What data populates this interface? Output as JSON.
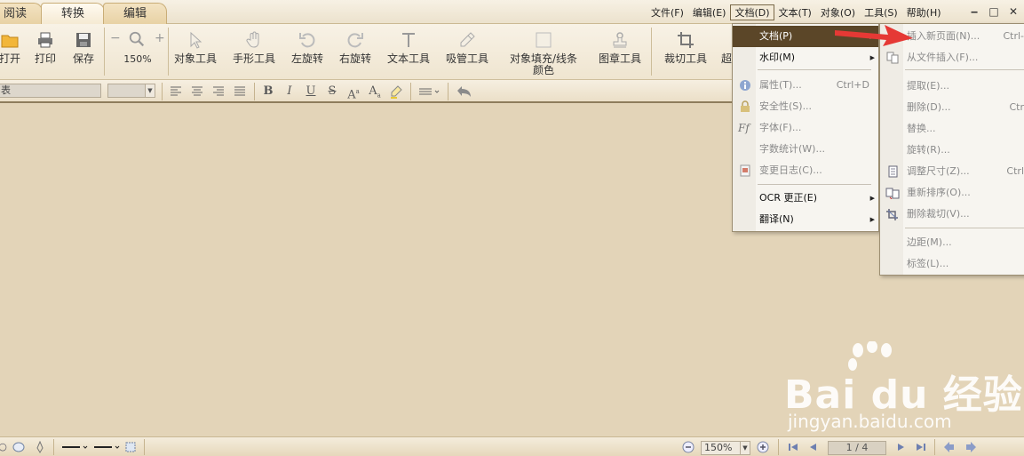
{
  "tabs": [
    "阅读",
    "转换",
    "编辑"
  ],
  "menubar": [
    "文件(F)",
    "编辑(E)",
    "文档(D)",
    "文本(T)",
    "对象(O)",
    "工具(S)",
    "帮助(H)"
  ],
  "window_buttons": [
    "‒",
    "□",
    "✕"
  ],
  "toolbar": {
    "open": "打开",
    "print": "打印",
    "save": "保存",
    "zoom_minus": "−",
    "zoom_plus": "+",
    "zoom": "150%",
    "object_tool": "对象工具",
    "hand_tool": "手形工具",
    "rotate_left": "左旋转",
    "rotate_right": "右旋转",
    "text_tool": "文本工具",
    "eyedropper": "吸管工具",
    "fill_stroke": "对象填充/线条颜色",
    "stamp_tool": "图章工具",
    "crop_tool": "裁切工具",
    "more": "超"
  },
  "format_bar": {
    "font_value": "表"
  },
  "doc_menu": {
    "items": [
      {
        "label": "文档(P)",
        "highlighted": true,
        "submenu": true
      },
      {
        "label": "水印(M)",
        "submenu": true
      },
      {
        "label": "属性(T)...",
        "shortcut": "Ctrl+D",
        "disabled": true
      },
      {
        "label": "安全性(S)...",
        "disabled": true
      },
      {
        "label": "字体(F)...",
        "disabled": true
      },
      {
        "label": "字数统计(W)...",
        "disabled": true
      },
      {
        "label": "变更日志(C)...",
        "disabled": true
      },
      {
        "label": "OCR 更正(E)",
        "submenu": true
      },
      {
        "label": "翻译(N)",
        "submenu": true
      }
    ],
    "font_icon_text": "Ff"
  },
  "page_submenu": {
    "items": [
      {
        "label": "插入新页面(N)...",
        "shortcut": "Ctrl-"
      },
      {
        "label": "从文件插入(F)..."
      },
      {
        "label": "提取(E)..."
      },
      {
        "label": "删除(D)...",
        "shortcut": "Ctr"
      },
      {
        "label": "替换..."
      },
      {
        "label": "旋转(R)..."
      },
      {
        "label": "调整尺寸(Z)...",
        "shortcut": "Ctrl"
      },
      {
        "label": "重新排序(O)..."
      },
      {
        "label": "删除裁切(V)..."
      },
      {
        "label": "边距(M)..."
      },
      {
        "label": "标签(L)..."
      }
    ]
  },
  "statusbar": {
    "zoom": "150%",
    "page": "1 / 4"
  },
  "watermark": {
    "logo": "Bai du 经验",
    "url": "jingyan.baidu.com"
  },
  "colors": {
    "background": "#e3d4b8",
    "highlight": "#5b4628",
    "arrow": "#e53935"
  }
}
